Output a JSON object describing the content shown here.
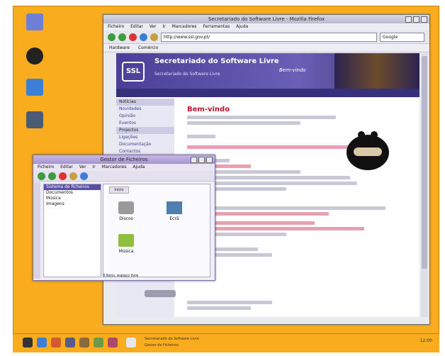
{
  "browser": {
    "title": "Secretariado do Software Livre - Mozilla Firefox",
    "menu": [
      "Ficheiro",
      "Editar",
      "Ver",
      "Ir",
      "Marcadores",
      "Ferramentas",
      "Ajuda"
    ],
    "url": "http://www.ssl.gov.pt/",
    "search_placeholder": "Google",
    "bookmarks": [
      "Hardware",
      "Comércio"
    ]
  },
  "page": {
    "logo": "SSL",
    "banner_title": "Secretariado do Software Livre",
    "banner_sub": "Secretariado do Software Livre",
    "banner_right": "Bem-vindo",
    "side": [
      {
        "text": "Notícias",
        "sec": true
      },
      {
        "text": "Novidades",
        "sec": false
      },
      {
        "text": "Opinião",
        "sec": false
      },
      {
        "text": "Eventos",
        "sec": false
      },
      {
        "text": "Projectos",
        "sec": true
      },
      {
        "text": "Ligações",
        "sec": false
      },
      {
        "text": "Documentação",
        "sec": false
      },
      {
        "text": "Contactos",
        "sec": false
      }
    ],
    "heading": "Bem-vindo"
  },
  "filemanager": {
    "title": "Gestor de Ficheiros",
    "menu": [
      "Ficheiro",
      "Editar",
      "Ver",
      "Ir",
      "Marcadores",
      "Ajuda"
    ],
    "tree": [
      {
        "text": "Sistema de ficheiros",
        "sel": true
      },
      {
        "text": "Documentos",
        "sel": false
      },
      {
        "text": "Música",
        "sel": false
      },
      {
        "text": "Imagens",
        "sel": false
      }
    ],
    "tab": "Início",
    "files": [
      "Discos",
      "Ecrã",
      "Música"
    ],
    "status": "3 itens, espaço livre"
  },
  "taskbar": {
    "tasks": [
      "Secretariado do Software Livre",
      "Gestor de Ficheiros"
    ],
    "clock": "12:00"
  },
  "colors": {
    "desktop": "#f9ac1e",
    "accent": "#4a3f96",
    "link": "#cc1a34"
  }
}
